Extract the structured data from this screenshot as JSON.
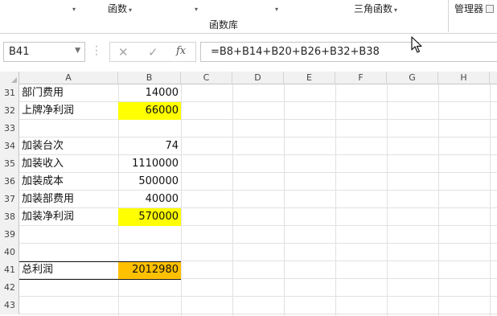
{
  "ribbon": {
    "items": [
      {
        "label": "",
        "has_dropdown": true
      },
      {
        "label": "函数",
        "has_dropdown": true
      },
      {
        "label": "",
        "has_dropdown": true
      },
      {
        "label": "",
        "has_dropdown": true
      },
      {
        "label": "三角函数",
        "has_dropdown": true
      },
      {
        "label": "管理器",
        "has_dropdown": false
      }
    ],
    "group_label": "函数库"
  },
  "formula_bar": {
    "name_box": "B41",
    "cancel_icon": "✕",
    "enter_icon": "✓",
    "fx_icon": "fx",
    "formula": "=B8+B14+B20+B26+B32+B38"
  },
  "columns": [
    "A",
    "B",
    "C",
    "D",
    "E",
    "F",
    "G",
    "H"
  ],
  "rows": [
    {
      "num": "31",
      "a": "部门费用",
      "b": "14000",
      "fill": ""
    },
    {
      "num": "32",
      "a": "上牌净利润",
      "b": "66000",
      "fill": "yellow"
    },
    {
      "num": "33",
      "a": "",
      "b": "",
      "fill": ""
    },
    {
      "num": "34",
      "a": "加装台次",
      "b": "74",
      "fill": ""
    },
    {
      "num": "35",
      "a": "加装收入",
      "b": "1110000",
      "fill": ""
    },
    {
      "num": "36",
      "a": "加装成本",
      "b": "500000",
      "fill": ""
    },
    {
      "num": "37",
      "a": "加装部费用",
      "b": "40000",
      "fill": ""
    },
    {
      "num": "38",
      "a": "加装净利润",
      "b": "570000",
      "fill": "yellow"
    },
    {
      "num": "39",
      "a": "",
      "b": "",
      "fill": ""
    },
    {
      "num": "40",
      "a": "",
      "b": "",
      "fill": ""
    },
    {
      "num": "41",
      "a": "总利润",
      "b": "2012980",
      "fill": "orange"
    },
    {
      "num": "42",
      "a": "",
      "b": "",
      "fill": ""
    },
    {
      "num": "43",
      "a": "",
      "b": "",
      "fill": ""
    }
  ],
  "colors": {
    "yellow": "#ffff00",
    "orange": "#ffc000"
  }
}
